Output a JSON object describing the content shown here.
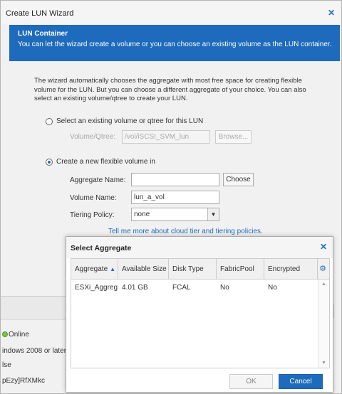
{
  "wizard": {
    "title": "Create LUN Wizard",
    "close_icon": "close-icon",
    "banner_title": "LUN Container",
    "banner_desc": "You can let the wizard create a volume or you can choose an existing volume as the LUN container.",
    "intro": "The wizard automatically chooses the aggregate with most free space for creating flexible volume for the LUN. But you can choose a different aggregate of your choice. You can also select an existing volume/qtree to create your LUN."
  },
  "existing_option": {
    "label": "Select an existing volume or qtree for this LUN",
    "selected": false,
    "volume_label": "Volume/Qtree:",
    "volume_value": "/vol/iSCSI_SVM_lun",
    "browse_label": "Browse..."
  },
  "new_option": {
    "label": "Create a new flexible volume in",
    "selected": true,
    "aggregate_label": "Aggregate Name:",
    "aggregate_value": "",
    "choose_label": "Choose",
    "volume_label": "Volume Name:",
    "volume_value": "lun_a_vol",
    "tiering_label": "Tiering Policy:",
    "tiering_value": "none",
    "cloud_link": "Tell me more about cloud tier and tiering policies."
  },
  "background": {
    "status": "Online",
    "os": "indows 2008 or later",
    "flag": "lse",
    "serial": "pEzy]RfXMkc"
  },
  "modal": {
    "title": "Select Aggregate",
    "columns": [
      "Aggregate",
      "Available Size",
      "Disk Type",
      "FabricPool",
      "Encrypted"
    ],
    "sort_indicator": "▲",
    "rows": [
      {
        "aggregate": "ESXi_Aggreg...",
        "size": "4.01 GB",
        "disk": "FCAL",
        "fabricpool": "No",
        "encrypted": "No"
      }
    ],
    "ok_label": "OK",
    "cancel_label": "Cancel",
    "gear_icon": "gear-icon"
  },
  "colors": {
    "accent": "#1e6bbd",
    "status_green": "#7cc043"
  }
}
